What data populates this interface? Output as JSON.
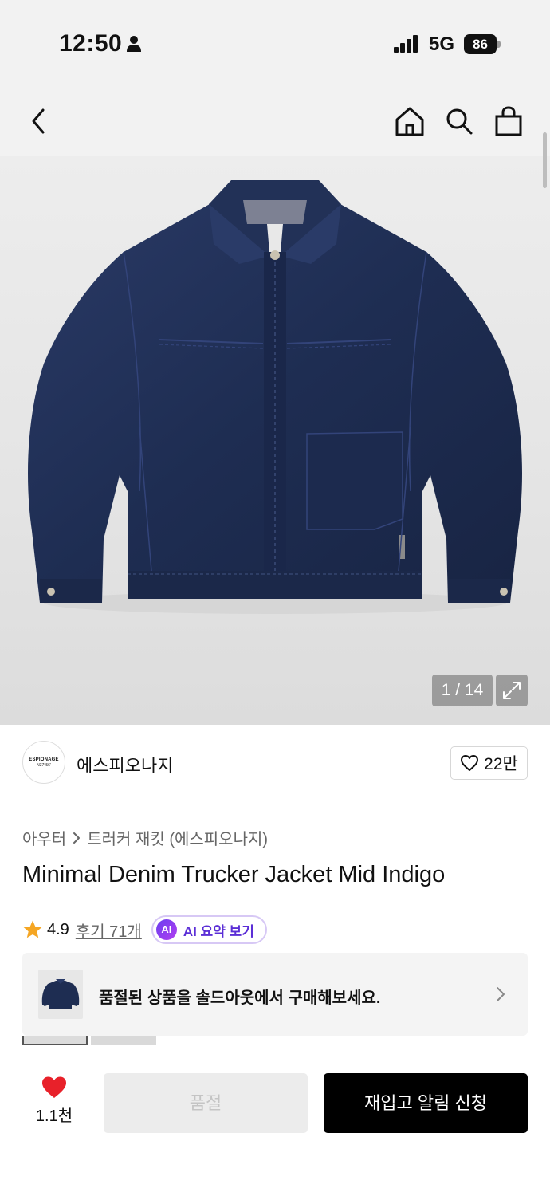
{
  "status_bar": {
    "time": "12:50",
    "network": "5G",
    "battery": "86"
  },
  "nav": {
    "back_icon": "chevron-left-icon",
    "home_icon": "home-icon",
    "search_icon": "search-icon",
    "cart_icon": "shopping-bag-icon"
  },
  "gallery": {
    "counter": "1 / 14",
    "expand_icon": "expand-icon"
  },
  "brand": {
    "logo_text": "ESPIONAGE",
    "logo_sub": "N37°56'",
    "name": "에스피오나지",
    "likes": "22만"
  },
  "product": {
    "breadcrumb": [
      "아우터",
      "트러커 재킷 (에스피오나지)"
    ],
    "title": "Minimal Denim Trucker Jacket Mid Indigo",
    "rating": "4.9",
    "review_link": "후기 71개",
    "ai_badge": "AI",
    "ai_summary": "AI 요약 보기"
  },
  "soldout_banner": {
    "text": "품절된 상품을 솔드아웃에서 구매해보세요."
  },
  "bottom": {
    "wish_count": "1.1천",
    "soldout_label": "품절",
    "restock_label": "재입고 알림 신청"
  },
  "colors": {
    "accent_purple": "#5b2ed6",
    "heart_red": "#e8212a",
    "star_orange": "#f5a623",
    "denim": "#1e2d52"
  }
}
